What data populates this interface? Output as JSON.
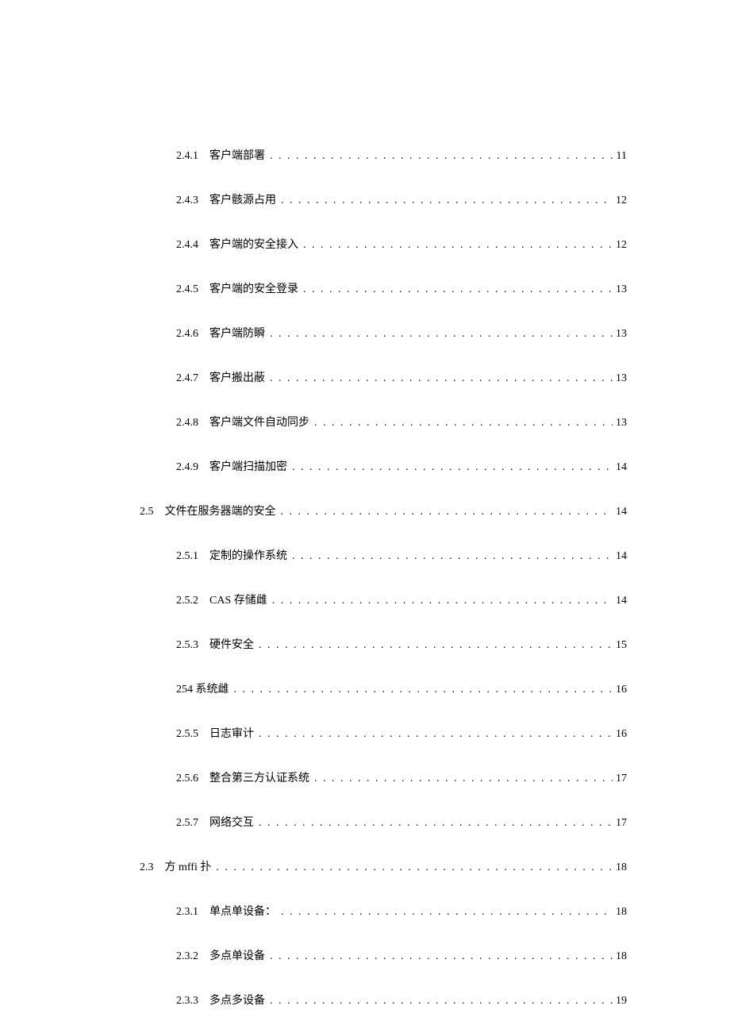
{
  "toc": [
    {
      "level": 3,
      "num": "2.4.1",
      "title": "客户端部署",
      "page": "11"
    },
    {
      "level": 3,
      "num": "2.4.3",
      "title": "客户骸源占用",
      "page": "12"
    },
    {
      "level": 3,
      "num": "2.4.4",
      "title": "客户端的安全接入",
      "page": "12"
    },
    {
      "level": 3,
      "num": "2.4.5",
      "title": "客户端的安全登录",
      "page": "13"
    },
    {
      "level": 3,
      "num": "2.4.6",
      "title": "客户端防瞬",
      "page": "13"
    },
    {
      "level": 3,
      "num": "2.4.7",
      "title": "客户搬出蔽",
      "page": "13"
    },
    {
      "level": 3,
      "num": "2.4.8",
      "title": "客户端文件自动同步",
      "page": "13"
    },
    {
      "level": 3,
      "num": "2.4.9",
      "title": "客户端扫描加密",
      "page": "14"
    },
    {
      "level": 2,
      "num": "2.5",
      "title": "文件在服务器端的安全",
      "page": "14"
    },
    {
      "level": 3,
      "num": "2.5.1",
      "title": "定制的操作系统",
      "page": "14"
    },
    {
      "level": 3,
      "num": "2.5.2",
      "title": "CAS 存储雌",
      "page": "14"
    },
    {
      "level": 3,
      "num": "2.5.3",
      "title": "硬件安全",
      "page": "15"
    },
    {
      "level": 3,
      "num": "",
      "title": "254 系统雌",
      "page": "16",
      "nonum": true
    },
    {
      "level": 3,
      "num": "2.5.5",
      "title": "日志审计",
      "page": "16"
    },
    {
      "level": 3,
      "num": "2.5.6",
      "title": "整合第三方认证系统",
      "page": "17"
    },
    {
      "level": 3,
      "num": "2.5.7",
      "title": "网络交互",
      "page": "17"
    },
    {
      "level": 2,
      "num": "2.3",
      "title": "方 mffi 扑",
      "page": "18"
    },
    {
      "level": 3,
      "num": "2.3.1",
      "title": "单点单设备：",
      "page": "18"
    },
    {
      "level": 3,
      "num": "2.3.2",
      "title": "多点单设备",
      "page": "18"
    },
    {
      "level": 3,
      "num": "2.3.3",
      "title": "多点多设备",
      "page": "19"
    }
  ]
}
